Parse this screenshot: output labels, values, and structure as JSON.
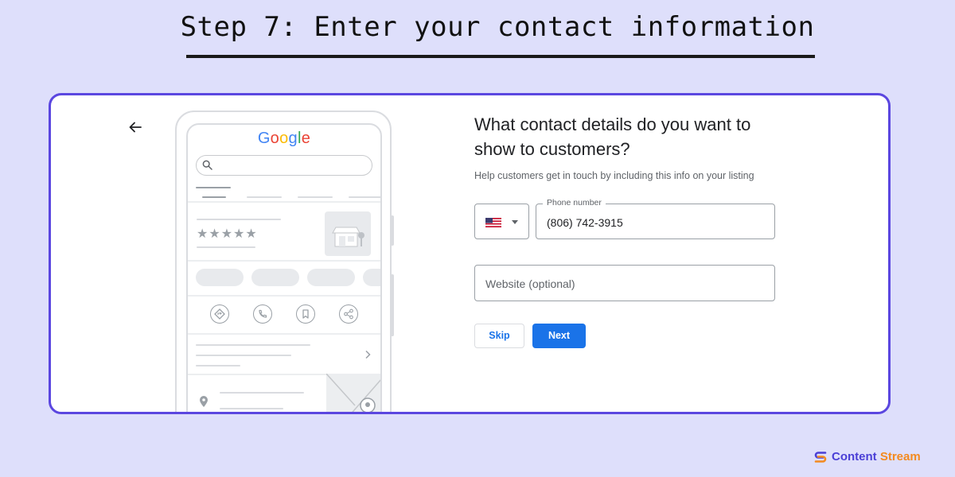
{
  "title": "Step 7: Enter your contact information",
  "phone_mockup": {
    "logo": [
      {
        "ch": "G",
        "color": "#4285F4"
      },
      {
        "ch": "o",
        "color": "#EA4335"
      },
      {
        "ch": "o",
        "color": "#FBBC05"
      },
      {
        "ch": "g",
        "color": "#4285F4"
      },
      {
        "ch": "l",
        "color": "#34A853"
      },
      {
        "ch": "e",
        "color": "#EA4335"
      }
    ],
    "stars": "★★★★★",
    "action_icons": [
      "directions-icon",
      "phone-icon",
      "bookmark-icon",
      "share-icon"
    ]
  },
  "form": {
    "heading": "What contact details do you want to show to customers?",
    "subtext": "Help customers get in touch by including this info on your listing",
    "country_flag": "us-flag",
    "phone_label": "Phone number",
    "phone_value": "(806) 742-3915",
    "website_placeholder": "Website (optional)",
    "skip_label": "Skip",
    "next_label": "Next",
    "accent_color": "#1a73e8"
  },
  "brand": {
    "word1": "Content",
    "word2": "Stream"
  }
}
